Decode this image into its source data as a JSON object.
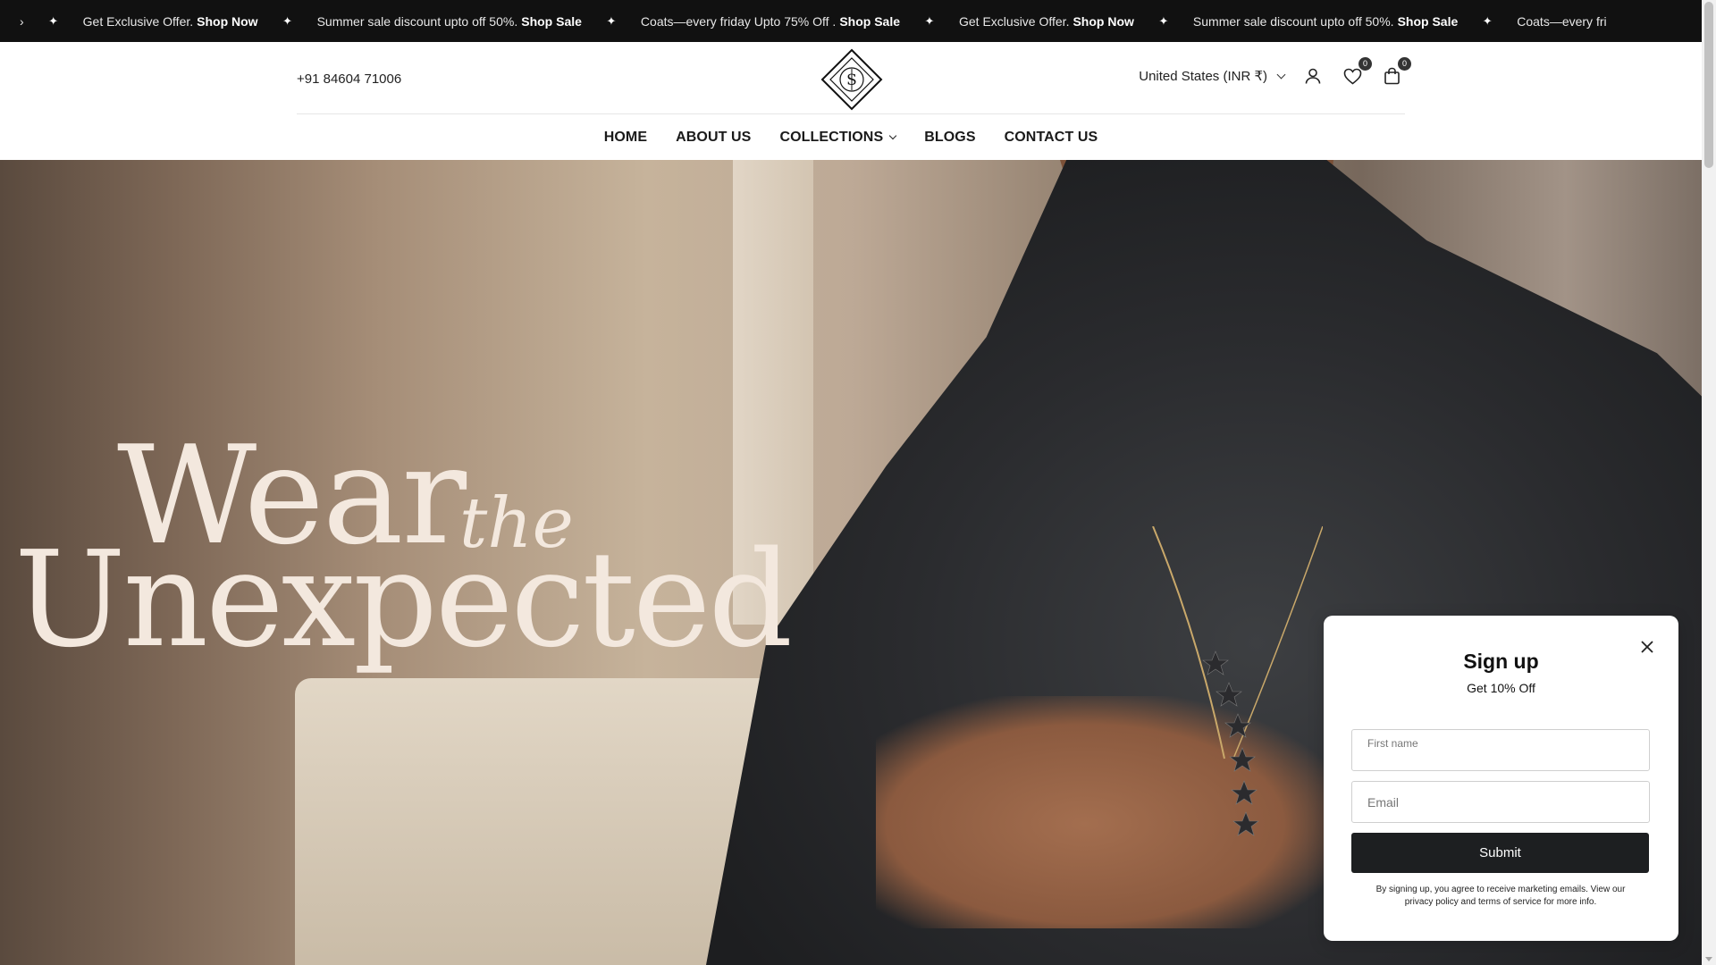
{
  "announcement": {
    "lead_fragment": "›",
    "separator": "✦",
    "items": [
      {
        "text": "Get Exclusive Offer.",
        "link": "Shop Now"
      },
      {
        "text": "Summer sale discount upto off 50%.",
        "link": "Shop Sale"
      },
      {
        "text": "Coats—every friday Upto 75% Off .",
        "link": "Shop Sale"
      },
      {
        "text": "Get Exclusive Offer.",
        "link": "Shop Now"
      },
      {
        "text": "Summer sale discount upto off 50%.",
        "link": "Shop Sale"
      }
    ],
    "trailing_fragment": "Coats—every fri"
  },
  "header": {
    "phone": "+91 84604 71006",
    "logo_icon": "diamond-s-monogram-logo",
    "country": "United States (INR ₹)",
    "icons": {
      "account": "user-icon",
      "wishlist": "heart-icon",
      "cart": "shopping-bag-icon"
    },
    "wishlist_count": "0",
    "cart_count": "0"
  },
  "nav": {
    "items": [
      "HOME",
      "ABOUT US",
      "COLLECTIONS",
      "BLOGS",
      "CONTACT US"
    ]
  },
  "hero": {
    "headline_word1": "Wear",
    "headline_word2": "the",
    "headline_word3": "Unexpected"
  },
  "popup": {
    "title": "Sign up",
    "subtitle": "Get 10% Off",
    "first_name_placeholder": "First name",
    "email_placeholder": "Email",
    "submit_label": "Submit",
    "fine_print": "By signing up, you agree to receive marketing emails. View our privacy policy and terms of service for more info."
  },
  "colors": {
    "announcement_bg": "#111111",
    "button_bg": "#1d1f21",
    "headline": "#f3e8de"
  }
}
